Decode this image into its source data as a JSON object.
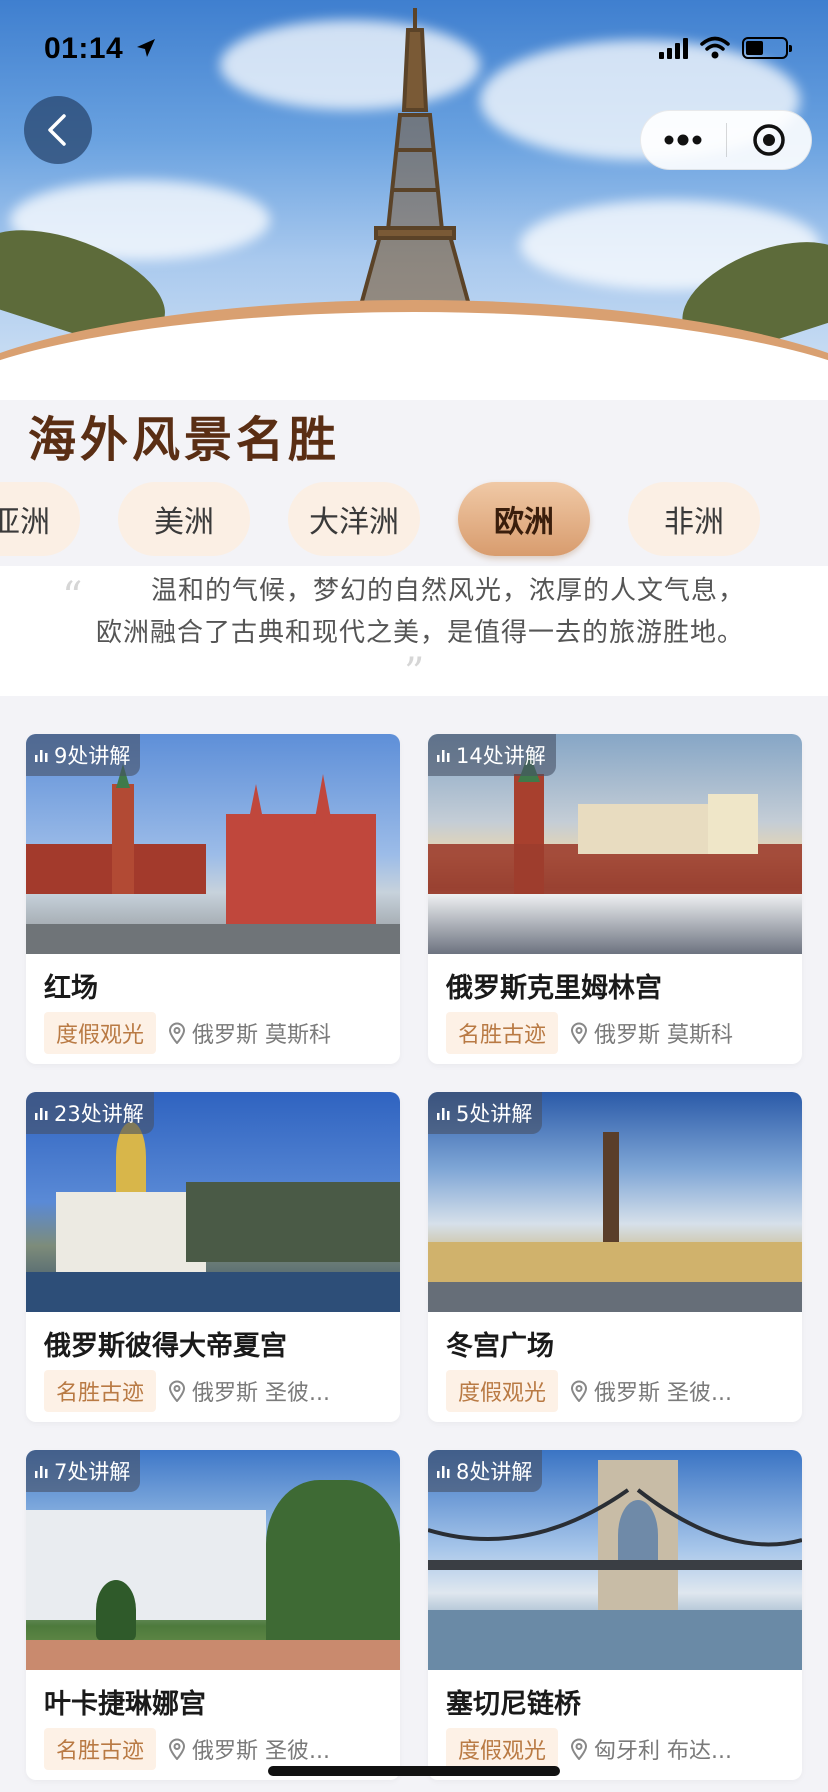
{
  "status_bar": {
    "time": "01:14"
  },
  "header": {
    "title": "海外风景名胜"
  },
  "tabs": [
    {
      "label": "亚洲",
      "active": false
    },
    {
      "label": "美洲",
      "active": false
    },
    {
      "label": "大洋洲",
      "active": false
    },
    {
      "label": "欧洲",
      "active": true
    },
    {
      "label": "非洲",
      "active": false
    }
  ],
  "intro": {
    "line1": "温和的气候，梦幻的自然风光，浓厚的人文气息，",
    "line2": "欧洲融合了古典和现代之美，是值得一去的旅游胜地。"
  },
  "cards": [
    {
      "badge": "9处讲解",
      "title": "红场",
      "tag": "度假观光",
      "location": "俄罗斯 莫斯科"
    },
    {
      "badge": "14处讲解",
      "title": "俄罗斯克里姆林宫",
      "tag": "名胜古迹",
      "location": "俄罗斯 莫斯科"
    },
    {
      "badge": "23处讲解",
      "title": "俄罗斯彼得大帝夏宫",
      "tag": "名胜古迹",
      "location": "俄罗斯 圣彼..."
    },
    {
      "badge": "5处讲解",
      "title": "冬宫广场",
      "tag": "度假观光",
      "location": "俄罗斯 圣彼..."
    },
    {
      "badge": "7处讲解",
      "title": "叶卡捷琳娜宫",
      "tag": "名胜古迹",
      "location": "俄罗斯 圣彼..."
    },
    {
      "badge": "8处讲解",
      "title": "塞切尼链桥",
      "tag": "度假观光",
      "location": "匈牙利 布达..."
    }
  ],
  "icons": {
    "back": "chevron-left-icon",
    "more": "more-dots-icon",
    "close": "target-circle-icon",
    "badge": "audio-bars-icon",
    "location": "location-pin-icon"
  },
  "colors": {
    "title": "#5a2e14",
    "tab_active": "#d89c6e",
    "tag_bg": "#fdf1e6",
    "tag_text": "#b97a44"
  }
}
